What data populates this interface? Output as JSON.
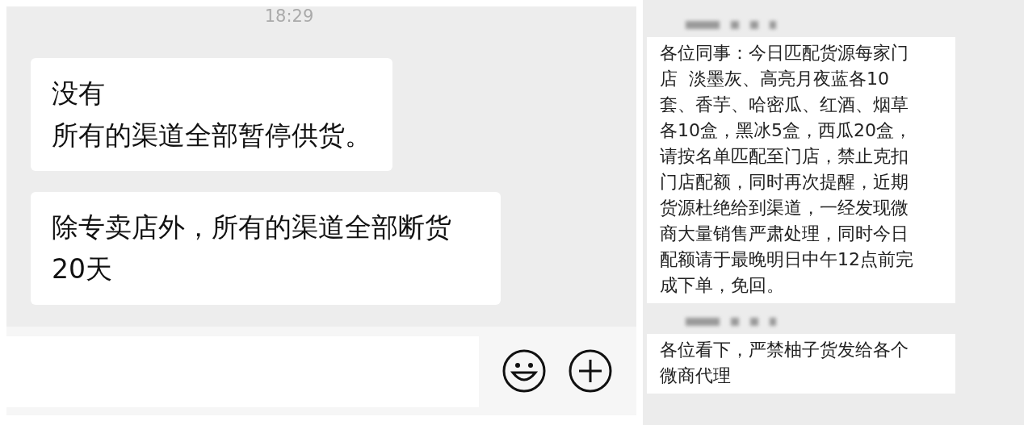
{
  "left_chat": {
    "time": "18:29",
    "messages": [
      {
        "lines": [
          "没有",
          "所有的渠道全部暂停供货。"
        ]
      },
      {
        "lines": [
          "除专卖店外，所有的渠道全部断货20天"
        ]
      }
    ]
  },
  "right_chat": {
    "messages": [
      {
        "text": "各位同事：今日匹配货源每家门店  淡墨灰、高亮月夜蓝各10套、香芋、哈密瓜、红酒、烟草各10盒，黑冰5盒，西瓜20盒，请按名单匹配至门店，禁止克扣门店配额，同时再次提醒，近期货源杜绝给到渠道，一经发现微商大量销售严肃处理，同时今日配额请于最晚明日中午12点前完成下单，免回。"
      },
      {
        "text": "各位看下，严禁柚子货发给各个微商代理"
      }
    ]
  }
}
